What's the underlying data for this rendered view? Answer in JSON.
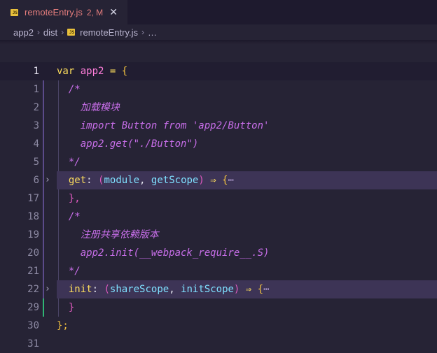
{
  "tab": {
    "icon_text": "JS",
    "filename": "remoteEntry.js",
    "status": "2, M",
    "close": "✕"
  },
  "breadcrumb": {
    "part1": "app2",
    "part2": "dist",
    "file": "remoteEntry.js",
    "more": "…",
    "sep": "›"
  },
  "gutter": {
    "l1": "1",
    "l2": "1",
    "l3": "2",
    "l4": "3",
    "l5": "4",
    "l6": "5",
    "l7": "6",
    "l8": "17",
    "l9": "18",
    "l10": "19",
    "l11": "20",
    "l12": "21",
    "l13": "22",
    "l14": "29",
    "l15": "30",
    "l16": "31"
  },
  "code": {
    "l1_kw": "var",
    "l1_name": "app2",
    "l1_eq": "=",
    "l1_brace": "{",
    "c_open": "/*",
    "l3": "加载模块",
    "l4": "import Button from 'app2/Button'",
    "l5": "app2.get(\"./Button\")",
    "c_close": "*/",
    "l7_prop": "get",
    "l7_colon": ":",
    "l7_p1": "module",
    "l7_comma": ",",
    "l7_p2": "getScope",
    "l7_arrow": "⇒",
    "l7_brace": "{",
    "l7_more": "⋯",
    "l8": "},",
    "l10": "注册共享依赖版本",
    "l11": "app2.init(__webpack_require__.S)",
    "l13_prop": "init",
    "l13_p1": "shareScope",
    "l13_p2": "initScope",
    "l14": "}",
    "l15": "};"
  },
  "colors": {
    "background": "#262335",
    "keyword": "#fede5d",
    "comment": "#c76ee8",
    "parameter": "#7fe0ff",
    "modified": "#2fb574"
  }
}
